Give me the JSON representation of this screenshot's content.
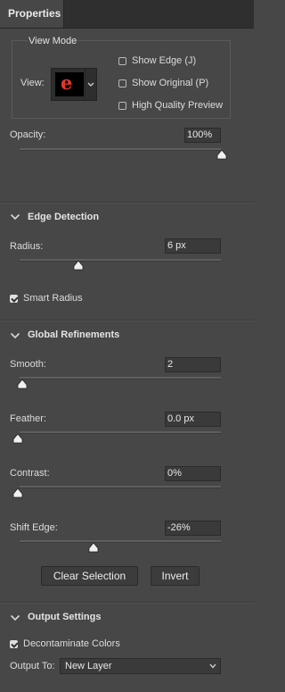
{
  "panel": {
    "tab_label": "Properties"
  },
  "view_mode": {
    "legend": "View Mode",
    "view_label": "View:",
    "thumbnail_letter": "e",
    "options": [
      {
        "label": "Show Edge (J)",
        "checked": false
      },
      {
        "label": "Show Original (P)",
        "checked": false
      },
      {
        "label": "High Quality Preview",
        "checked": false
      }
    ]
  },
  "opacity": {
    "label": "Opacity:",
    "value": "100%",
    "level": 1.0
  },
  "edge_detection": {
    "title": "Edge Detection",
    "radius": {
      "label": "Radius:",
      "value": "6 px",
      "level": 0.29
    },
    "smart_radius": {
      "label": "Smart Radius",
      "checked": true
    }
  },
  "global_refinements": {
    "title": "Global Refinements",
    "smooth": {
      "label": "Smooth:",
      "value": "2",
      "level": 0.01
    },
    "feather": {
      "label": "Feather:",
      "value": "0.0 px",
      "level": 0.0
    },
    "contrast": {
      "label": "Contrast:",
      "value": "0%",
      "level": 0.0
    },
    "shift_edge": {
      "label": "Shift Edge:",
      "value": "-26%",
      "level": 0.37
    },
    "clear_selection_label": "Clear Selection",
    "invert_label": "Invert"
  },
  "output_settings": {
    "title": "Output Settings",
    "decontaminate": {
      "label": "Decontaminate Colors",
      "checked": true
    },
    "output_to_label": "Output To:",
    "output_to_value": "New Layer"
  },
  "colors": {
    "panel_bg": "#474747",
    "thumb_letter": "#e2392a"
  }
}
